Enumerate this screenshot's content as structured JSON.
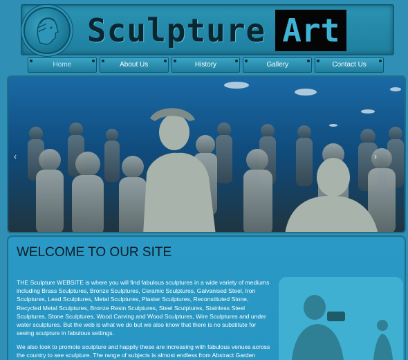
{
  "header": {
    "logo_icon": "greek-head-medallion-icon",
    "title_word1": "Sculpture",
    "title_word2": "Art"
  },
  "nav": {
    "items": [
      {
        "label": "Home",
        "active": true
      },
      {
        "label": "About Us",
        "active": false
      },
      {
        "label": "History",
        "active": false
      },
      {
        "label": "Gallery",
        "active": false
      },
      {
        "label": "Contact Us",
        "active": false
      }
    ]
  },
  "hero": {
    "prev_icon": "‹",
    "next_icon": "›"
  },
  "main": {
    "heading": "WELCOME TO OUR SITE",
    "paragraph1": "THE Sculpture WEBSITE is where you will find fabulous sculptures in a wide variety of mediums including Brass Sculptures, Bronze Sculptures, Ceramic Sculptures, Galvanised Steel, Iron Sculptures, Lead Sculptures, Metal Sculptures, Plaster Sculptures, Reconstituted Stone, Recycled Metal Sculptures, Bronze Resin Sculptures, Steel Sculptures, Stainless Steel Sculptures, Stone Sculptures, Wood Carving and Wood Sculptures, Wire Sculptures and under water sculptures. But the web is what we do but we also know that there is no substitute for seeing sculpture in fabulous settings.",
    "paragraph2": "We also look to promote sculpture and happily these are increasing with fabulous venues across the country to see sculpture. The range of subjects is almost endless from Abstract Garden Sculptures,"
  },
  "colors": {
    "page_bg": "#2f8fb4",
    "header_black": "#050505",
    "title_accent": "#3fb3d4",
    "content_bg": "#2b99c6"
  }
}
